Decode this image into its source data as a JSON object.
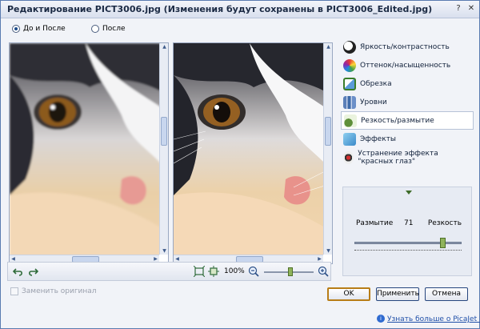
{
  "window": {
    "title": "Редактирование PICT3006.jpg (Изменения будут сохранены в PICT3006_Edited.jpg)",
    "controls": {
      "help_glyph": "?",
      "close_glyph": "✕"
    }
  },
  "view_mode": {
    "options": [
      {
        "label": "До и После",
        "selected": true
      },
      {
        "label": "После",
        "selected": false
      }
    ]
  },
  "viewports": {
    "before": {
      "image": "cat-closeup-before",
      "state": "blurred"
    },
    "after": {
      "image": "cat-closeup-after",
      "state": "sharpened"
    },
    "scrollbar_arrows": {
      "up": "▲",
      "down": "▼",
      "left": "◀",
      "right": "▶"
    }
  },
  "toolbar": {
    "undo_icon": "undo-arrow",
    "redo_icon": "redo-arrow",
    "zoom_label": "100%",
    "zoom_out_glyph": "−",
    "zoom_in_glyph": "+",
    "zoom_level_fraction": 0.5,
    "accent_color": "#8fb35b"
  },
  "tools": [
    {
      "label": "Яркость/контрастность",
      "icon": "brightness-icon",
      "active": false
    },
    {
      "label": "Оттенок/насыщенность",
      "icon": "hue-icon",
      "active": false
    },
    {
      "label": "Обрезка",
      "icon": "crop-icon",
      "active": false
    },
    {
      "label": "Уровни",
      "icon": "levels-icon",
      "active": false
    },
    {
      "label": "Резкость/размытие",
      "icon": "sharpness-icon",
      "active": true
    },
    {
      "label": "Эффекты",
      "icon": "effects-icon",
      "active": false
    },
    {
      "label": "Устранение эффекта \"красных глаз\"",
      "icon": "red-eye-icon",
      "active": false
    }
  ],
  "sharpness": {
    "left_label": "Размытие",
    "value": "71",
    "right_label": "Резкость",
    "slider_fraction": 0.8
  },
  "replace_original": {
    "label": "Заменить оригинал",
    "checked": false,
    "enabled": false
  },
  "buttons": {
    "ok": "OK",
    "apply": "Применить",
    "cancel": "Отмена"
  },
  "footer": {
    "link": "Узнать больше о PicaJet FX",
    "info_glyph": "i"
  }
}
